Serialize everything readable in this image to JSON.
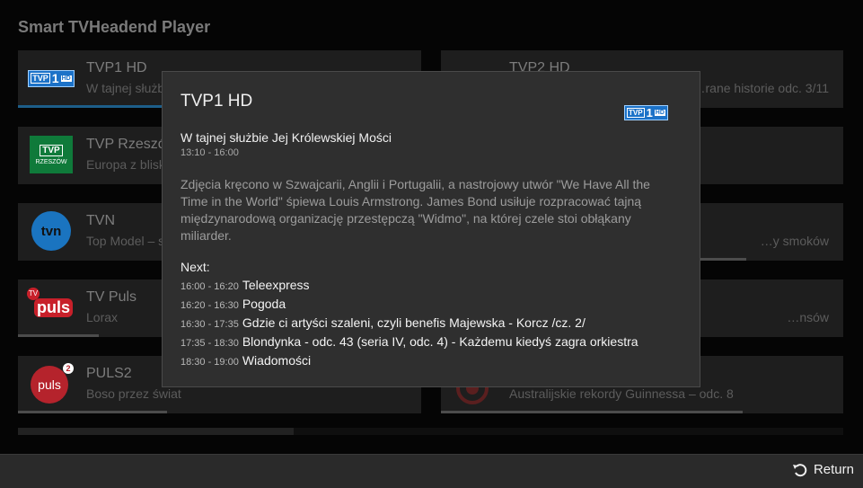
{
  "app": {
    "title": "Smart TVHeadend Player"
  },
  "channels": [
    {
      "name": "TVP1 HD",
      "program": "W tajnej służbie Jej Królewskiej Mości",
      "progress": 0.5
    },
    {
      "name": "TVP Rzeszów",
      "program": "Europa z bliska",
      "progress": 0.0
    },
    {
      "name": "TVN",
      "program": "Top Model – s",
      "progress": 0.0
    },
    {
      "name": "TV Puls",
      "program": "Lorax",
      "progress": 0.2
    },
    {
      "name": "PULS2",
      "program": "Boso przez świat",
      "progress": 0.37
    },
    {
      "name": "TVP2 HD",
      "program": "…rane historie odc. 3/11",
      "progress": 0.0
    },
    {
      "name": "",
      "program": "",
      "progress": 0.0
    },
    {
      "name": "",
      "program": "…y smoków",
      "progress": 0.76
    },
    {
      "name": "",
      "program": "…nsów",
      "progress": 0.0
    },
    {
      "name": "",
      "program": "Australijskie rekordy Guinnessa – odc. 8",
      "progress": 0.75
    }
  ],
  "logos": {
    "tvp1_text": "TVP",
    "tvp1_num": "1",
    "tvp1_hd": "HD",
    "rzeszow_top": "TVP",
    "rzeszow_bottom": "RZESZÓW",
    "tvn": "tvn",
    "puls": "puls",
    "puls2": "puls",
    "puls2_num": "2",
    "puls_tv": "TV"
  },
  "details": {
    "channel": "TVP1 HD",
    "title": "W tajnej służbie Jej Królewskiej Mości",
    "time": "13:10 - 16:00",
    "description": "Zdjęcia kręcono w Szwajcarii, Anglii i Portugalii, a nastrojowy utwór \"We Have All the Time in the World\" śpiewa Louis Armstrong. James Bond usiłuje rozpracować tajną międzynarodową organizację przestępczą \"Widmo\", na której czele stoi obłąkany miliarder.",
    "next_label": "Next:",
    "next": [
      {
        "time": "16:00 - 16:20",
        "title": "Teleexpress"
      },
      {
        "time": "16:20 - 16:30",
        "title": "Pogoda"
      },
      {
        "time": "16:30 - 17:35",
        "title": "Gdzie ci artyści szaleni, czyli benefis Majewska - Korcz /cz. 2/"
      },
      {
        "time": "17:35 - 18:30",
        "title": "Blondynka - odc. 43 (seria IV, odc. 4) - Każdemu kiedyś zagra orkiestra"
      },
      {
        "time": "18:30 - 19:00",
        "title": "Wiadomości"
      }
    ]
  },
  "footer": {
    "return_label": "Return"
  },
  "colors": {
    "accent": "#1d5e89",
    "modal_bg": "#2f2f2f",
    "logo_blue": "#1c72c8"
  }
}
